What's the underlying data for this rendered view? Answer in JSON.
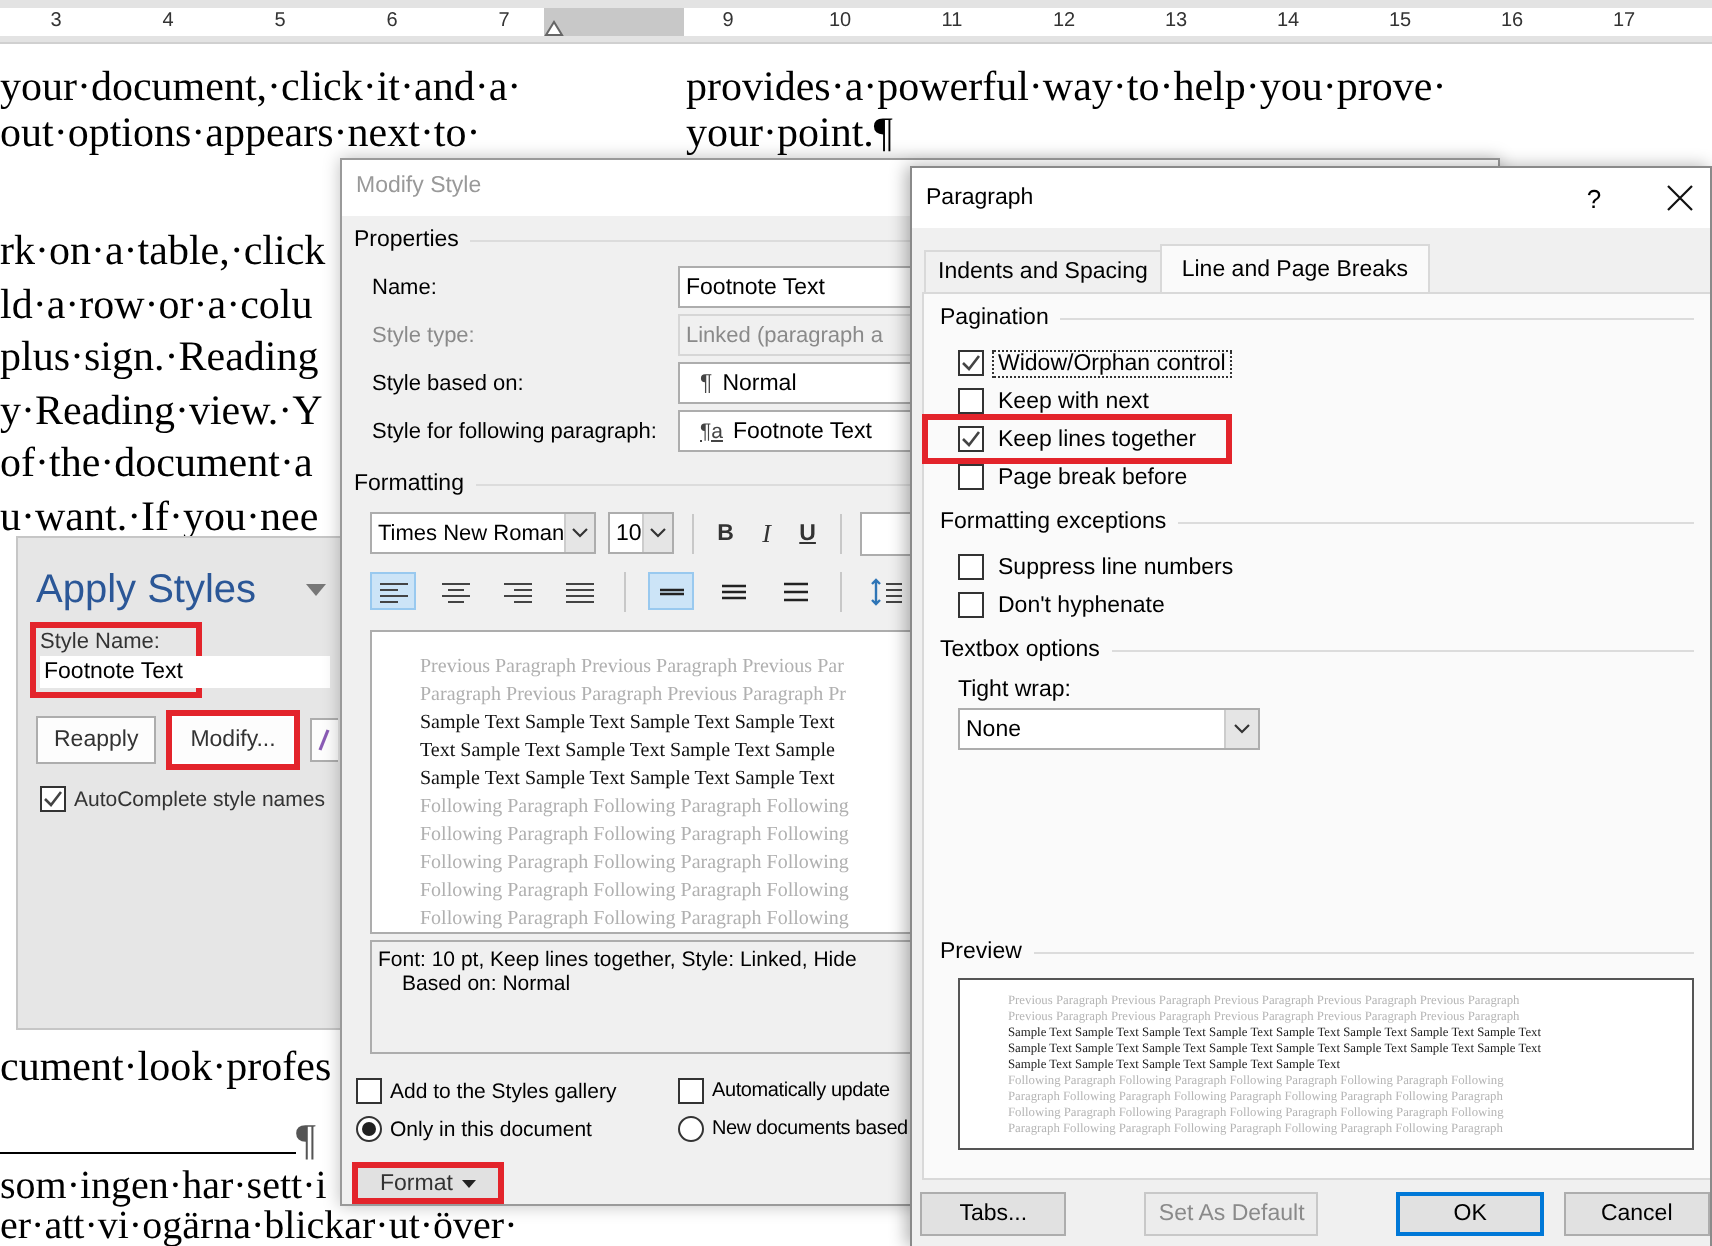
{
  "ruler": {
    "numbers": [
      "3",
      "4",
      "5",
      "6",
      "7",
      "9",
      "10",
      "11",
      "12",
      "13",
      "14",
      "15",
      "16",
      "17"
    ]
  },
  "document": {
    "column_1": [
      {
        "kind": "text",
        "lines": [
          "your·document,·click·it·and·a·",
          "out·options·appears·next·to·"
        ]
      },
      {
        "kind": "text",
        "lines": [
          "rk·on·a·table,·click",
          "ld·a·row·or·a·colu",
          "plus·sign.·Reading",
          "y·Reading·view.·Y",
          "of·the·document·a",
          "u·want.·If·you·nee"
        ]
      },
      {
        "kind": "text",
        "lines": [
          "cument·look·profes"
        ]
      },
      {
        "kind": "rule",
        "mark": "¶"
      },
      {
        "kind": "text",
        "lines": [
          "som·ingen·har·sett·i",
          "er·att·vi·ogärna·blickar·ut·över·"
        ]
      }
    ],
    "column_2": [
      {
        "kind": "text",
        "lines": [
          "provides·a·powerful·way·to·help·you·prove·",
          "your·point.¶"
        ]
      }
    ]
  },
  "apply_styles": {
    "title": "Apply Styles",
    "style_name_label": "Style Name:",
    "style_name_value": "Footnote Text",
    "style_name_highlighted": true,
    "buttons": [
      {
        "label": "Reapply",
        "highlighted": false
      },
      {
        "label": "Modify...",
        "highlighted": true
      }
    ],
    "autocomplete": {
      "label": "AutoComplete style names",
      "checked": true
    }
  },
  "modify_style": {
    "title": "Modify Style",
    "properties_header": "Properties",
    "properties": [
      {
        "label": "Name:",
        "value": "Footnote Text",
        "disabled": false
      },
      {
        "label": "Style type:",
        "value": "Linked (paragraph a",
        "disabled": true
      },
      {
        "label": "Style based on:",
        "glyph": "¶",
        "value": "Normal",
        "disabled": false
      },
      {
        "label": "Style for following paragraph:",
        "glyph": "¶a",
        "value": "Footnote Text",
        "disabled": false
      }
    ],
    "formatting_header": "Formatting",
    "font": "Times New Roman",
    "size": "10",
    "styles": [
      {
        "label": "B",
        "kind": "bold"
      },
      {
        "label": "I",
        "kind": "italic"
      },
      {
        "label": "U",
        "kind": "underline"
      }
    ],
    "alignment": [
      {
        "kind": "left",
        "selected": true
      },
      {
        "kind": "center",
        "selected": false
      },
      {
        "kind": "right",
        "selected": false
      },
      {
        "kind": "justify",
        "selected": false
      }
    ],
    "spacing": [
      {
        "kind": "single",
        "selected": true
      },
      {
        "kind": "onehalf",
        "selected": false
      },
      {
        "kind": "double",
        "selected": false
      }
    ],
    "preview": [
      {
        "kind": "previous",
        "text": "Previous Paragraph Previous Paragraph Previous Par"
      },
      {
        "kind": "previous",
        "text": "Paragraph Previous Paragraph Previous Paragraph Pr"
      },
      {
        "kind": "sample",
        "text": "Sample Text Sample Text Sample Text Sample Text"
      },
      {
        "kind": "sample",
        "text": "Text Sample Text Sample Text Sample Text Sample"
      },
      {
        "kind": "sample",
        "text": "Sample Text Sample Text Sample Text Sample Text"
      },
      {
        "kind": "following",
        "text": "Following Paragraph Following Paragraph Following"
      },
      {
        "kind": "following",
        "text": "Following Paragraph Following Paragraph Following"
      },
      {
        "kind": "following",
        "text": "Following Paragraph Following Paragraph Following"
      },
      {
        "kind": "following",
        "text": "Following Paragraph Following Paragraph Following"
      },
      {
        "kind": "following",
        "text": "Following Paragraph Following Paragraph Following"
      }
    ],
    "description": [
      "Font: 10 pt, Keep lines together, Style: Linked, Hide",
      "Based on: Normal"
    ],
    "options": [
      {
        "label": "Add to the Styles gallery",
        "checked": false
      },
      {
        "label": "Automatically update",
        "checked": false
      }
    ],
    "scope": [
      {
        "label": "Only in this document",
        "selected": true
      },
      {
        "label": "New documents based",
        "selected": false
      }
    ],
    "format_button": {
      "label": "Format",
      "highlighted": true
    }
  },
  "paragraph": {
    "title": "Paragraph",
    "help": "?",
    "tabs": [
      {
        "label": "Indents and Spacing",
        "selected": false
      },
      {
        "label": "Line and Page Breaks",
        "selected": true
      }
    ],
    "sections": [
      {
        "header": "Pagination",
        "options": [
          {
            "label": "Widow/Orphan control",
            "checked": true,
            "focused": true,
            "highlighted": false
          },
          {
            "label": "Keep with next",
            "checked": false,
            "focused": false,
            "highlighted": false
          },
          {
            "label": "Keep lines together",
            "checked": true,
            "focused": false,
            "highlighted": true
          },
          {
            "label": "Page break before",
            "checked": false,
            "focused": false,
            "highlighted": false
          }
        ]
      },
      {
        "header": "Formatting exceptions",
        "options": [
          {
            "label": "Suppress line numbers",
            "checked": false,
            "focused": false,
            "highlighted": false
          },
          {
            "label": "Don't hyphenate",
            "checked": false,
            "focused": false,
            "highlighted": false
          }
        ]
      }
    ],
    "textbox_header": "Textbox options",
    "tight_wrap_label": "Tight wrap:",
    "tight_wrap_value": "None",
    "preview_header": "Preview",
    "preview": [
      {
        "kind": "previous",
        "text": "Previous Paragraph Previous Paragraph Previous Paragraph Previous Paragraph Previous Paragraph"
      },
      {
        "kind": "previous",
        "text": "Previous Paragraph Previous Paragraph Previous Paragraph Previous Paragraph Previous Paragraph"
      },
      {
        "kind": "sample",
        "text": "Sample Text Sample Text Sample Text Sample Text Sample Text Sample Text Sample Text Sample Text"
      },
      {
        "kind": "sample",
        "text": "Sample Text Sample Text Sample Text Sample Text Sample Text Sample Text Sample Text Sample Text"
      },
      {
        "kind": "sample",
        "text": "Sample Text Sample Text Sample Text Sample Text Sample Text"
      },
      {
        "kind": "following",
        "text": "Following Paragraph Following Paragraph Following Paragraph Following Paragraph Following"
      },
      {
        "kind": "following",
        "text": "Paragraph Following Paragraph Following Paragraph Following Paragraph Following Paragraph"
      },
      {
        "kind": "following",
        "text": "Following Paragraph Following Paragraph Following Paragraph Following Paragraph Following"
      },
      {
        "kind": "following",
        "text": "Paragraph Following Paragraph Following Paragraph Following Paragraph Following Paragraph"
      }
    ],
    "buttons": [
      {
        "label": "Tabs...",
        "kind": "normal"
      },
      {
        "label": "Set As Default",
        "kind": "disabled"
      },
      {
        "label": "OK",
        "kind": "default"
      },
      {
        "label": "Cancel",
        "kind": "normal"
      }
    ]
  }
}
